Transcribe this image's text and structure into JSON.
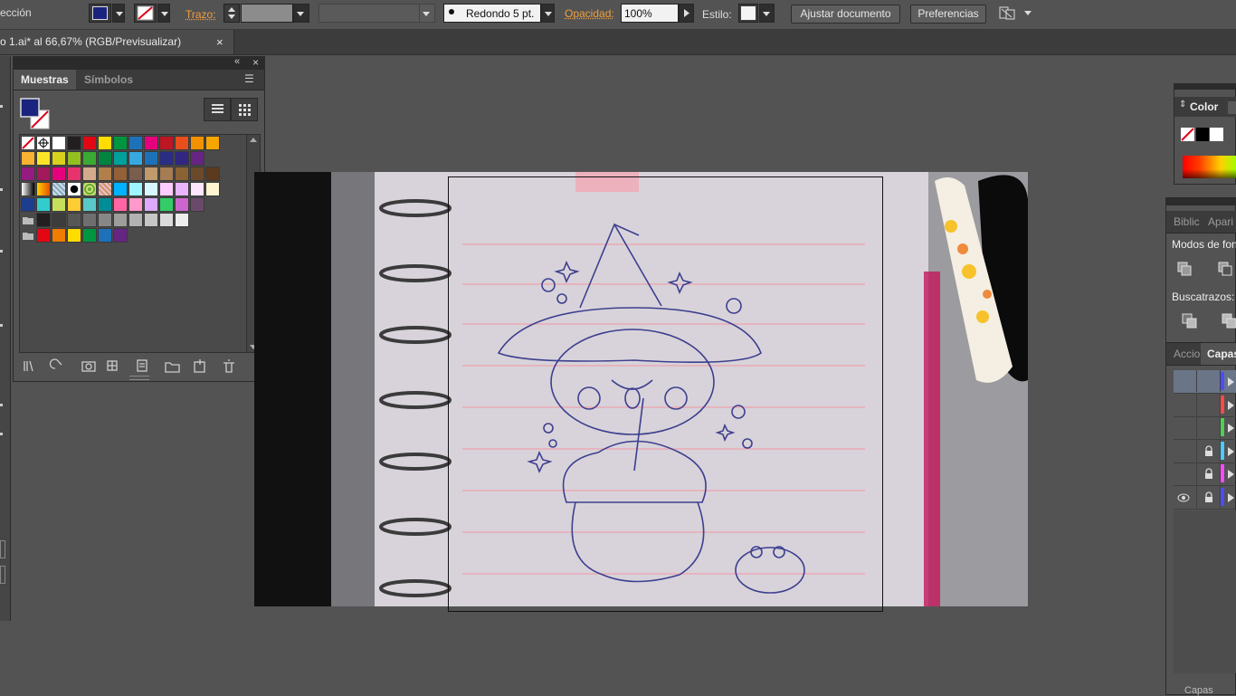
{
  "control_bar": {
    "selection_label": "ección",
    "stroke_label": "Trazo:",
    "brush_label": "Redondo 5 pt.",
    "opacity_label": "Opacidad:",
    "opacity_value": "100%",
    "style_label": "Estilo:",
    "document_setup_button": "Ajustar documento",
    "preferences_button": "Preferencias",
    "fill_color": "#1a237e"
  },
  "document_tab": {
    "title": "o 1.ai* al 66,67% (RGB/Previsualizar)",
    "close": "×"
  },
  "swatches_panel": {
    "tabs": [
      "Muestras",
      "Símbolos"
    ],
    "collapse_icon": "«",
    "close_icon": "×",
    "menu_icon": "☰",
    "rows": [
      [
        "none",
        "register",
        "#ffffff",
        "#231f20",
        "#e30613",
        "#ffdd00",
        "#009640",
        "#1d71b8",
        "#e6007e",
        "#be1622",
        "#e94e1b",
        "#f39200",
        "#f7a600"
      ],
      [
        "#f9b233",
        "#fce529",
        "#d8d21d",
        "#93c01f",
        "#3aaa35",
        "#00843f",
        "#00a19a",
        "#36a9e1",
        "#1d71b8",
        "#2a2e83",
        "#312782",
        "#662483"
      ],
      [
        "#951b81",
        "#a3195b",
        "#e6007e",
        "#e6336d",
        "#d3ab8c",
        "#b17f4a",
        "#936037",
        "#7b5d4e",
        "#c09a6b",
        "#a67c52",
        "#8b6234",
        "#6b4a2b",
        "#5b3a1e"
      ],
      [
        "grad-bw",
        "grad-orange",
        "pattern-1",
        "pattern-2",
        "pattern-3",
        "pattern-4",
        "#00b2ff",
        "#9ff5ff",
        "#d9f7ff",
        "#ffccff",
        "#e9b5ff",
        "#ffe6ff",
        "#fff5d0"
      ],
      [
        "#1d3e8f",
        "#33cccc",
        "#c5e05a",
        "#ffcc33",
        "#5ac8c8",
        "#008c96",
        "#ff66a3",
        "#ff99cc",
        "#ddaaff",
        "#33cc66",
        "#cc66cc",
        "#6a4a6a"
      ],
      [
        "folder",
        "#231f20",
        "#3c3c3c",
        "#575756",
        "#706f6f",
        "#878787",
        "#9d9d9c",
        "#b2b2b2",
        "#c6c6c6",
        "#dadada",
        "#ededed"
      ],
      [
        "folder",
        "#e30613",
        "#ef7d00",
        "#ffdd00",
        "#009640",
        "#1d71b8",
        "#662483"
      ]
    ],
    "footer_icons": [
      "library-icon",
      "swatch-options-icon",
      "swatch-kind-icon",
      "new-color-group-icon",
      "swatch-options-2-icon",
      "new-folder-icon",
      "new-swatch-icon",
      "delete-swatch-icon"
    ]
  },
  "color_panel": {
    "title": "Color"
  },
  "libraries_panel": {
    "tabs": [
      "Biblic",
      "Apari"
    ],
    "pathfinder_label": "Modos de fon",
    "pathfinders_label": "Buscatrazos:"
  },
  "layers_panel": {
    "tabs": [
      "Accio",
      "Capas"
    ],
    "layer_colors": [
      "#4c4cff",
      "#ff4a4a",
      "#4fce4f",
      "#4acbff",
      "#ff4aff",
      "#4c4cff"
    ],
    "bottom_label": "Capas"
  }
}
